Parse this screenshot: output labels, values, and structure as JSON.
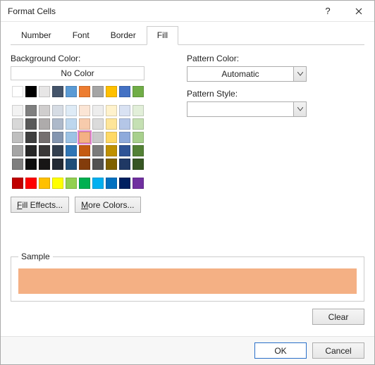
{
  "window": {
    "title": "Format Cells",
    "help": "?",
    "close": "×"
  },
  "tabs": {
    "items": [
      "Number",
      "Font",
      "Border",
      "Fill"
    ],
    "active_index": 3
  },
  "fill": {
    "background_label": "Background Color:",
    "no_color_label": "No Color",
    "fill_effects_btn": "Fill Effects...",
    "more_colors_btn": "More Colors...",
    "pattern_color_label": "Pattern Color:",
    "pattern_color_value": "Automatic",
    "pattern_style_label": "Pattern Style:",
    "pattern_style_value": ""
  },
  "sample": {
    "legend": "Sample",
    "color": "#f4b084"
  },
  "buttons": {
    "clear": "Clear",
    "ok": "OK",
    "cancel": "Cancel"
  },
  "palette": {
    "row0": [
      "#ffffff",
      "#000000",
      "#e7e6e6",
      "#44546a",
      "#5b9bd5",
      "#ed7d31",
      "#a5a5a5",
      "#ffc000",
      "#4472c4",
      "#70ad47"
    ],
    "theme_tints": [
      [
        "#f2f2f2",
        "#7f7f7f",
        "#d0cece",
        "#d6dce4",
        "#deebf6",
        "#fbe5d5",
        "#ededed",
        "#fff2cc",
        "#d9e2f3",
        "#e2efd9"
      ],
      [
        "#d8d8d8",
        "#595959",
        "#aeabab",
        "#adb9ca",
        "#bdd7ee",
        "#f7cbac",
        "#dbdbdb",
        "#fee599",
        "#b4c6e7",
        "#c5e0b3"
      ],
      [
        "#bfbfbf",
        "#3f3f3f",
        "#757070",
        "#8496b0",
        "#9cc3e5",
        "#f4b084",
        "#c9c9c9",
        "#ffd965",
        "#8eaadb",
        "#a8d08d"
      ],
      [
        "#a5a5a5",
        "#262626",
        "#3a3838",
        "#323f4f",
        "#2e75b5",
        "#c55a11",
        "#7b7b7b",
        "#bf9000",
        "#2f5496",
        "#538135"
      ],
      [
        "#7f7f7f",
        "#0c0c0c",
        "#171616",
        "#222a35",
        "#1e4e79",
        "#833c0b",
        "#525252",
        "#7f6000",
        "#1f3864",
        "#375623"
      ]
    ],
    "standard": [
      "#c00000",
      "#ff0000",
      "#ffc000",
      "#ffff00",
      "#92d050",
      "#00b050",
      "#00b0f0",
      "#0070c0",
      "#002060",
      "#7030a0"
    ],
    "selected": {
      "row": 2,
      "col": 5
    }
  }
}
